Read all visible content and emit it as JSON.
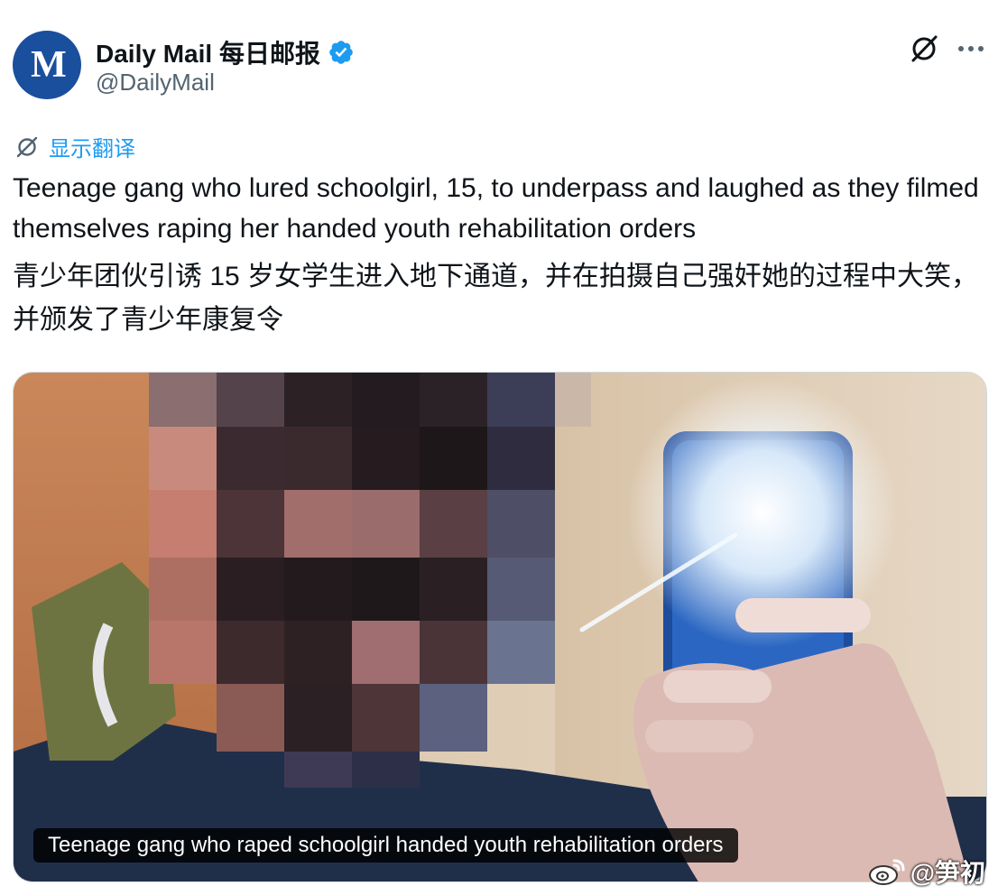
{
  "tweet": {
    "author": {
      "display_name": "Daily Mail 每日邮报",
      "handle": "@DailyMail",
      "avatar_icon": "daily-mail-logo",
      "avatar_letters": "M"
    },
    "actions": {
      "grok_icon": "grok-icon",
      "more_icon": "more-options-icon"
    },
    "translate_label": "显示翻译",
    "text_en": "Teenage gang who lured schoolgirl, 15, to underpass and laughed as they filmed themselves raping her handed youth rehabilitation orders",
    "text_zh": "青少年团伙引诱 15 岁女学生进入地下通道，并在拍摄自己强奸她的过程中大笑，并颁发了青少年康复令",
    "media": {
      "caption": "Teenage gang who raped schoolgirl handed youth rehabilitation orders"
    }
  },
  "watermark": {
    "icon": "weibo-logo-icon",
    "text": "@笋初"
  },
  "colors": {
    "link": "#1d9bf0",
    "text": "#0f1419",
    "secondary": "#536471",
    "avatar_bg": "#1a4f9e",
    "verified": "#1d9bf0"
  }
}
